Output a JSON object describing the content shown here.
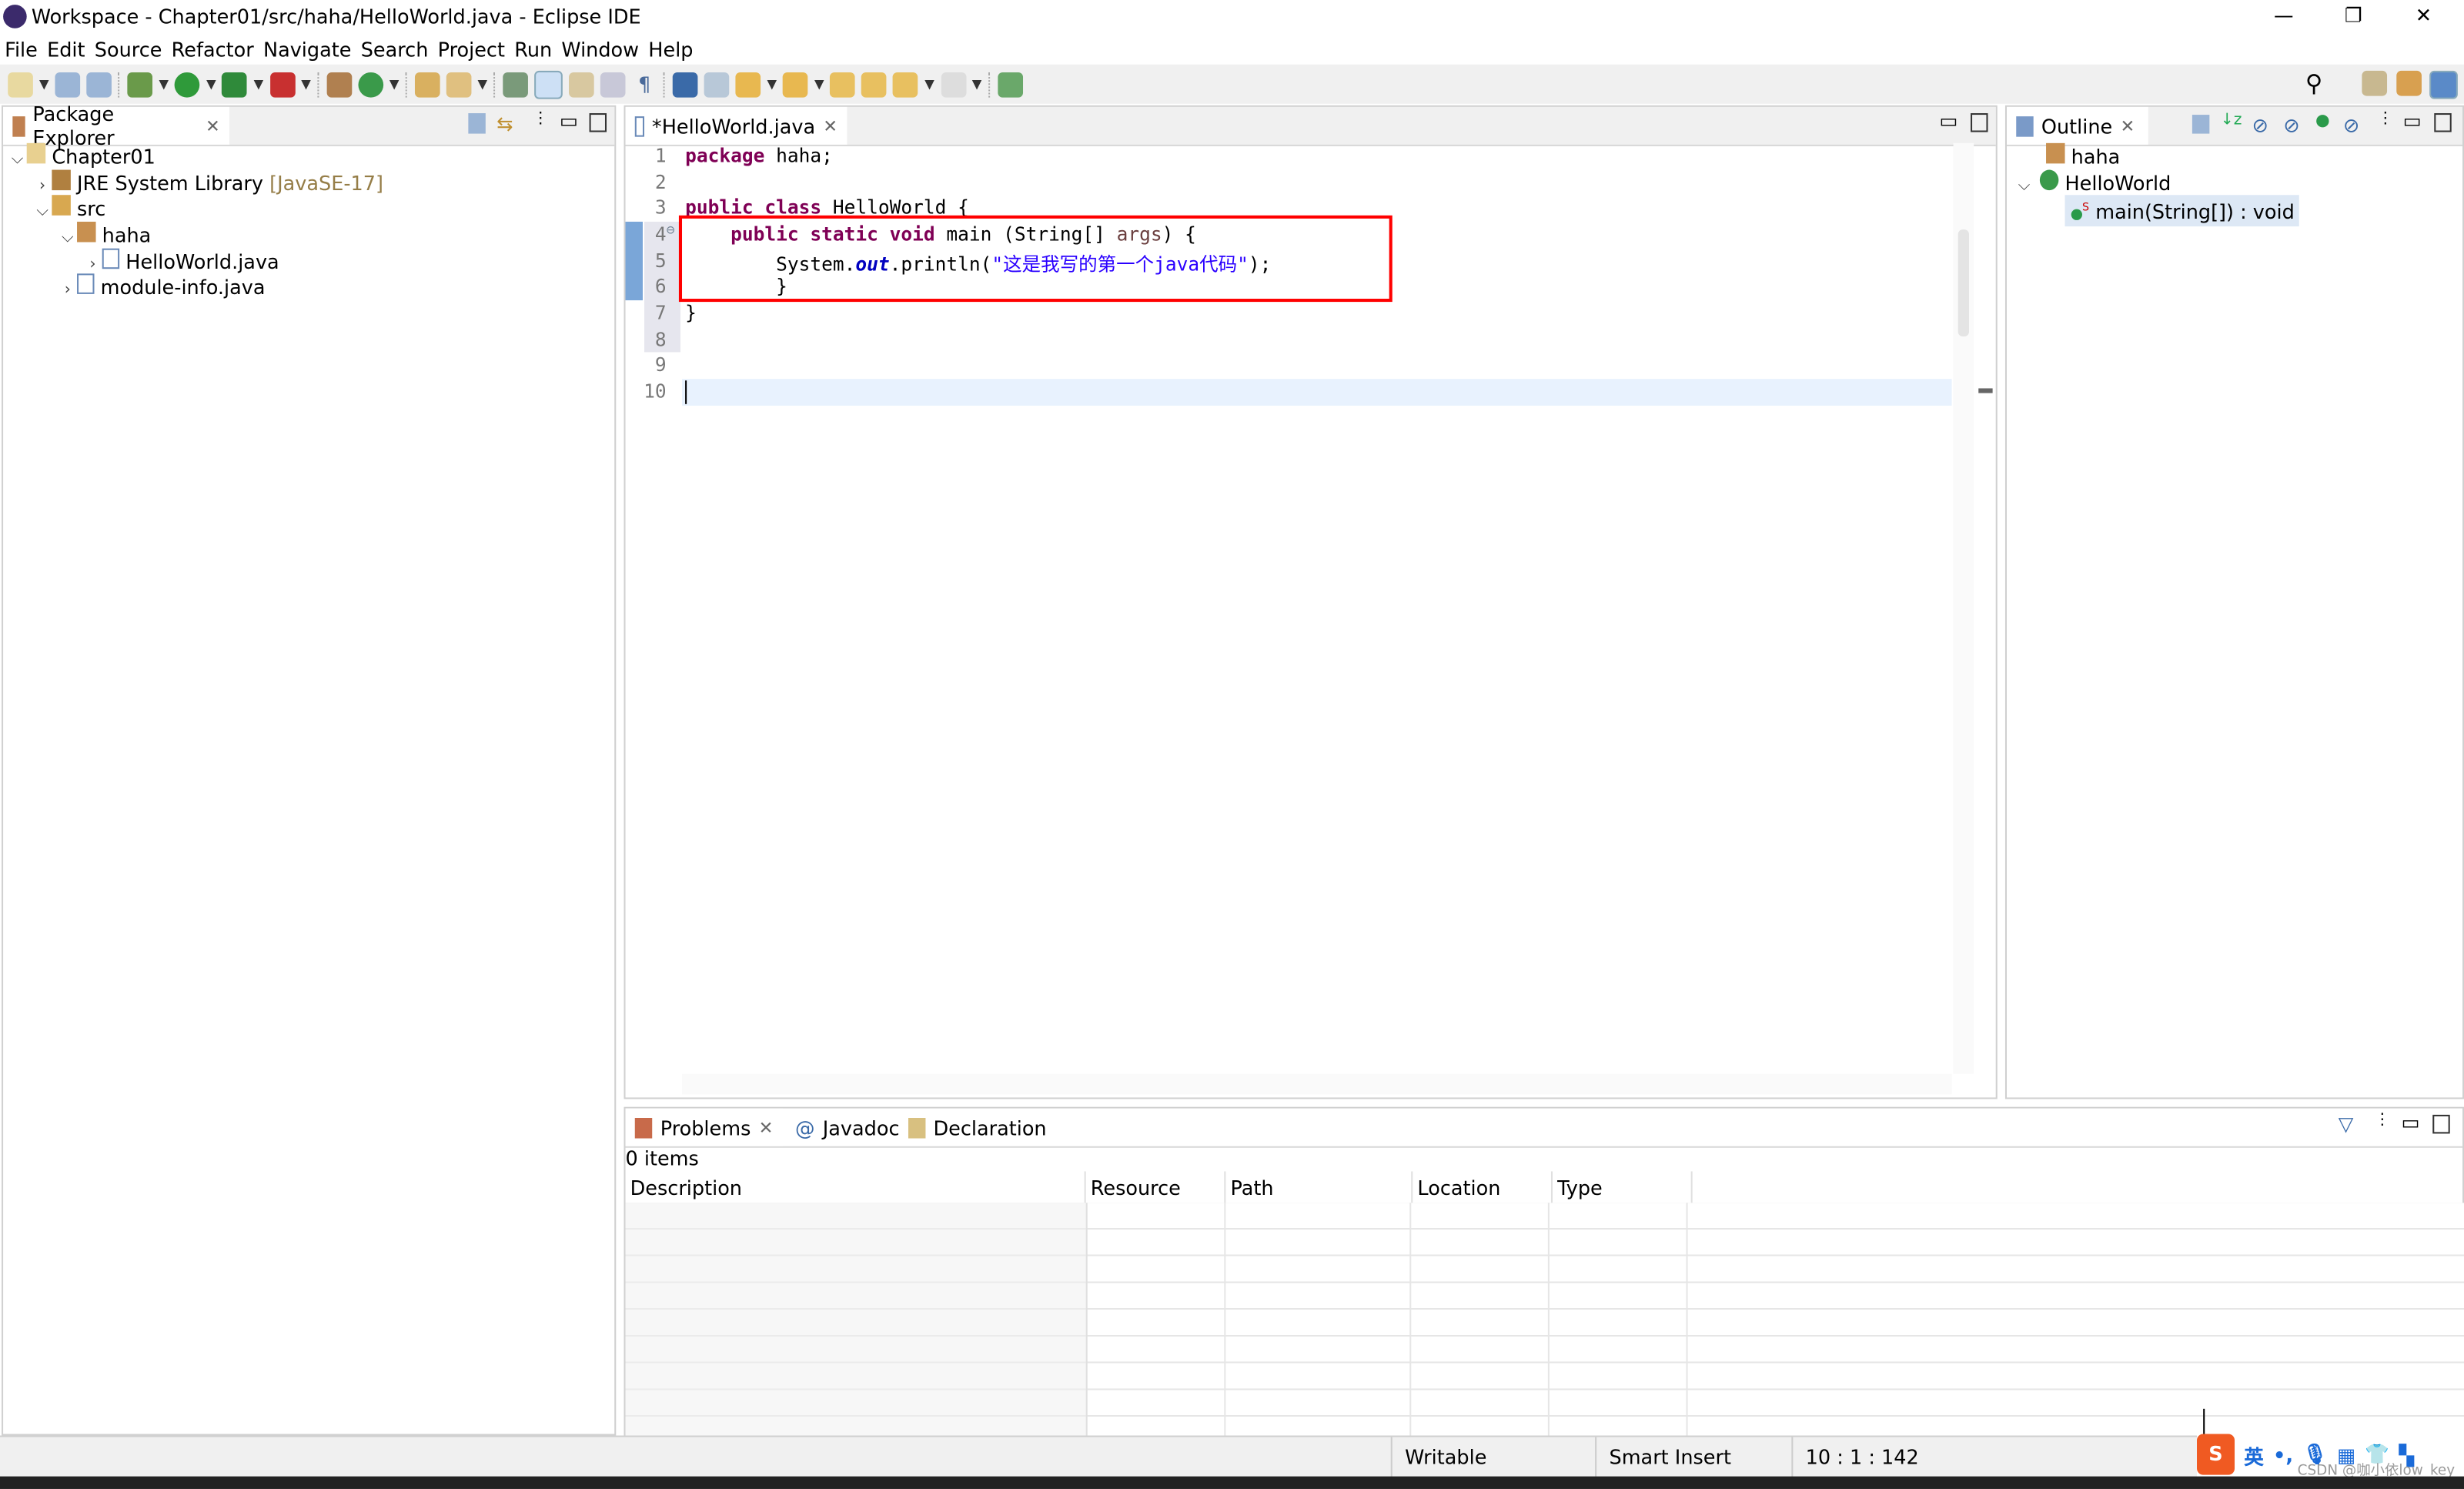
{
  "window": {
    "title": "Workspace - Chapter01/src/haha/HelloWorld.java - Eclipse IDE",
    "minimize": "—",
    "restore": "❐",
    "close": "✕"
  },
  "menu": [
    "File",
    "Edit",
    "Source",
    "Refactor",
    "Navigate",
    "Search",
    "Project",
    "Run",
    "Window",
    "Help"
  ],
  "package_explorer": {
    "tab": "Package Explorer",
    "tree": [
      {
        "label": "Chapter01",
        "extra": ""
      },
      {
        "label": "JRE System Library",
        "extra": "[JavaSE-17]"
      },
      {
        "label": "src",
        "extra": ""
      },
      {
        "label": "haha",
        "extra": ""
      },
      {
        "label": "HelloWorld.java",
        "extra": ""
      },
      {
        "label": "module-info.java",
        "extra": ""
      }
    ]
  },
  "editor": {
    "tab": "*HelloWorld.java",
    "line_numbers": [
      "1",
      "2",
      "3",
      "4",
      "5",
      "6",
      "7",
      "8",
      "9",
      "10"
    ],
    "code": {
      "l1_kw": "package",
      "l1_rest": " haha;",
      "l3_kw": "public class",
      "l3_rest": " HelloWorld {",
      "l4_indent": "    ",
      "l4_kw": "public static void",
      "l4_rest": " main (String[] ",
      "l4_arg": "args",
      "l4_end": ") {",
      "l5_a": "        System.",
      "l5_field": "out",
      "l5_b": ".println(",
      "l5_str": "\"这是我写的第一个java代码\"",
      "l5_end": ");",
      "l6": "        }",
      "l7": "}"
    },
    "highlight_color": "#ff0000"
  },
  "outline": {
    "tab": "Outline",
    "items": [
      "haha",
      "HelloWorld",
      "main(String[]) : void"
    ]
  },
  "bottom": {
    "tabs": [
      "Problems",
      "Javadoc",
      "Declaration"
    ],
    "count": "0 items",
    "columns": [
      "Description",
      "Resource",
      "Path",
      "Location",
      "Type"
    ]
  },
  "status": {
    "writable": "Writable",
    "insert_mode": "Smart Insert",
    "position": "10 : 1 : 142"
  },
  "ime": {
    "lang": "英",
    "punct": "•,",
    "watermark": "CSDN @咖小依low_key"
  }
}
